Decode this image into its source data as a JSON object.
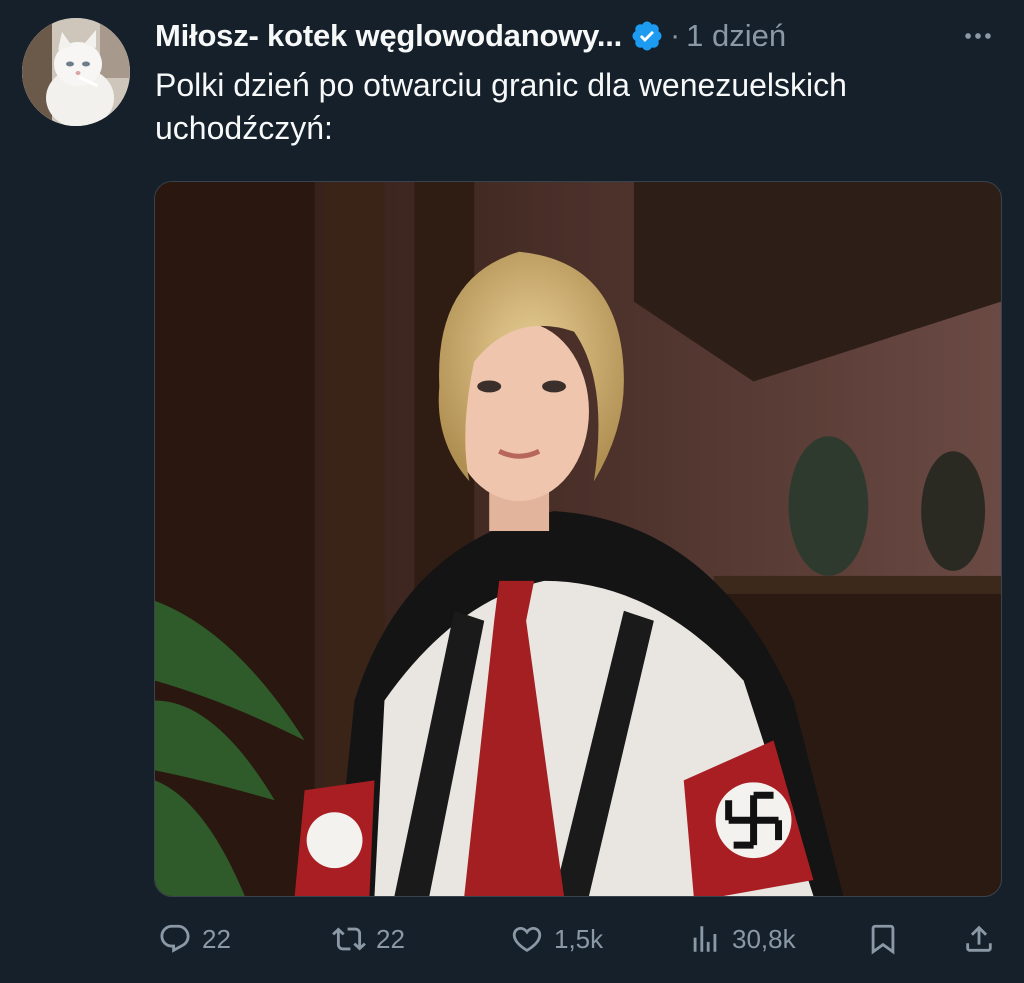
{
  "post": {
    "author_name": "Miłosz- kotek węglowodanowy...",
    "separator": "·",
    "time": "1 dzień",
    "text": "Polki dzień po otwarciu granic dla wenezuelskich uchodźczyń:"
  },
  "actions": {
    "replies": "22",
    "reposts": "22",
    "likes": "1,5k",
    "views": "30,8k"
  },
  "icons": {
    "more": "more-horizontal-icon",
    "verified": "verified-badge-icon",
    "reply": "reply-icon",
    "repost": "repost-icon",
    "like": "heart-icon",
    "views": "views-chart-icon",
    "bookmark": "bookmark-icon",
    "share": "share-icon"
  },
  "colors": {
    "background": "#15202b",
    "text": "#f7f9f9",
    "muted": "#8b98a5",
    "verified": "#1d9bf0"
  }
}
